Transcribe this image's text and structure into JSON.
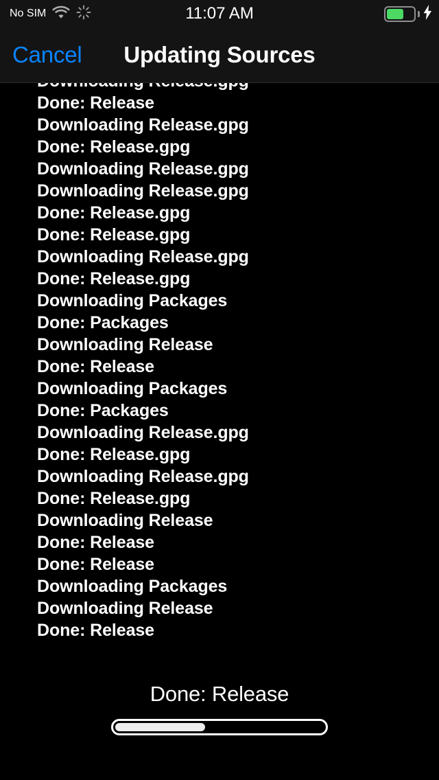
{
  "status_bar": {
    "carrier": "No SIM",
    "wifi_icon": "wifi-icon",
    "activity_icon": "spinner-icon",
    "time": "11:07 AM",
    "battery_icon": "battery-icon",
    "battery_percent": 62,
    "battery_color": "#4cd964",
    "charging_icon": "lightning-bolt-icon",
    "charging": true
  },
  "nav_bar": {
    "cancel_label": "Cancel",
    "title": "Updating Sources",
    "accent_color": "#0a84ff"
  },
  "log": {
    "lines": [
      "Downloading Release.gpg",
      "Done: Release",
      "Downloading Release.gpg",
      "Done: Release.gpg",
      "Downloading Release.gpg",
      "Downloading Release.gpg",
      "Done: Release.gpg",
      "Done: Release.gpg",
      "Downloading Release.gpg",
      "Done: Release.gpg",
      "Downloading Packages",
      "Done: Packages",
      "Downloading Release",
      "Done: Release",
      "Downloading Packages",
      "Done: Packages",
      "Downloading Release.gpg",
      "Done: Release.gpg",
      "Downloading Release.gpg",
      "Done: Release.gpg",
      "Downloading Release",
      "Done: Release",
      "Done: Release",
      "Downloading Packages",
      "Downloading Release",
      "Done: Release"
    ]
  },
  "footer": {
    "status_message": "Done: Release",
    "progress_percent": 43
  }
}
